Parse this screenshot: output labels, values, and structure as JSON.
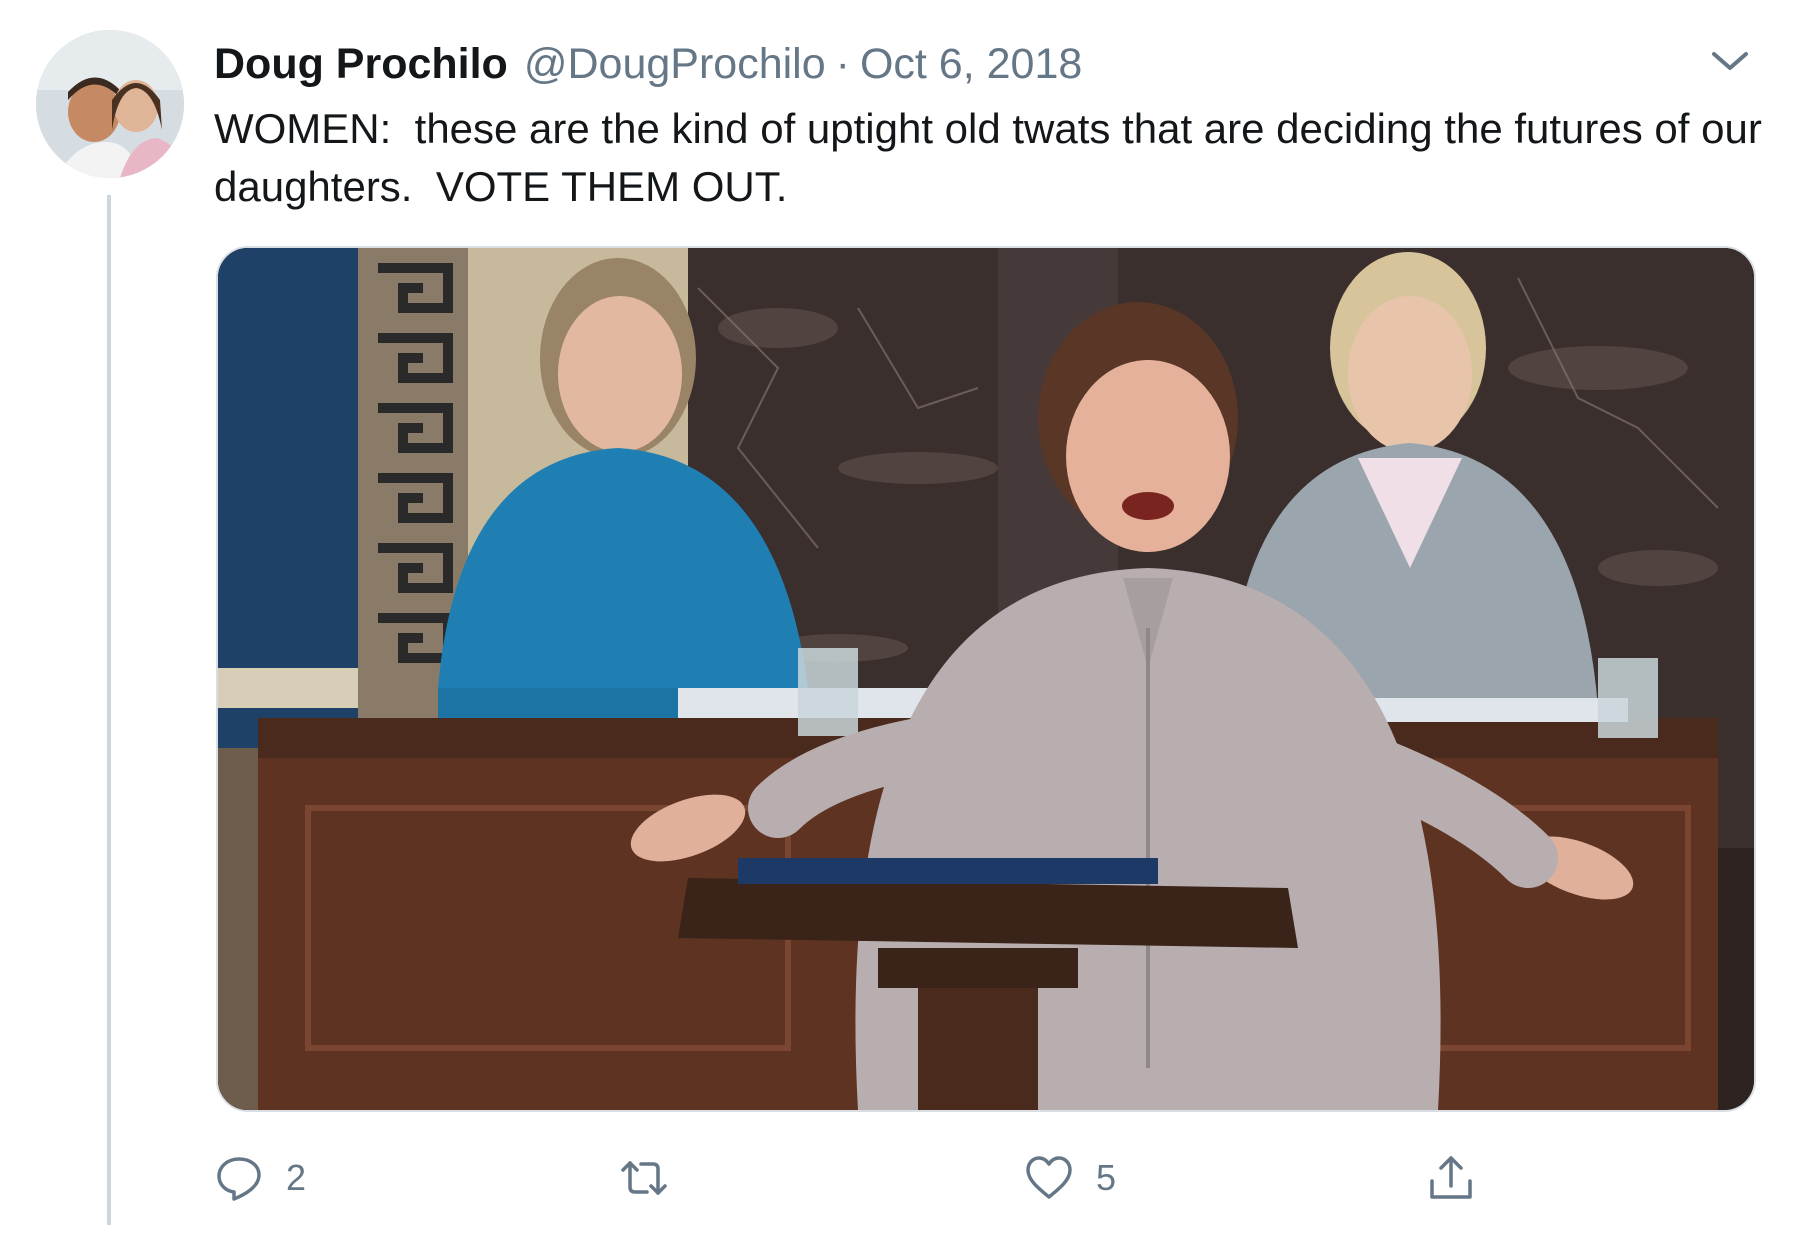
{
  "tweet": {
    "author": {
      "display_name": "Doug Prochilo",
      "handle": "@DougProchilo",
      "avatar_icon": "profile-photo"
    },
    "separator": "·",
    "date": "Oct 6, 2018",
    "text": "WOMEN:  these are the kind of uptight old twats that are deciding the futures of our daughters.  VOTE THEM OUT.",
    "media": {
      "kind": "photo",
      "icon": "photo-senate-floor"
    },
    "actions": {
      "reply": {
        "icon": "reply-icon",
        "count": "2"
      },
      "retweet": {
        "icon": "retweet-icon",
        "count": ""
      },
      "like": {
        "icon": "heart-icon",
        "count": "5"
      },
      "share": {
        "icon": "share-icon"
      }
    },
    "menu_icon": "chevron-down-icon"
  },
  "colors": {
    "text_primary": "#14171a",
    "text_secondary": "#657786",
    "thread_line": "#ccd6dd",
    "icon": "#657786"
  }
}
